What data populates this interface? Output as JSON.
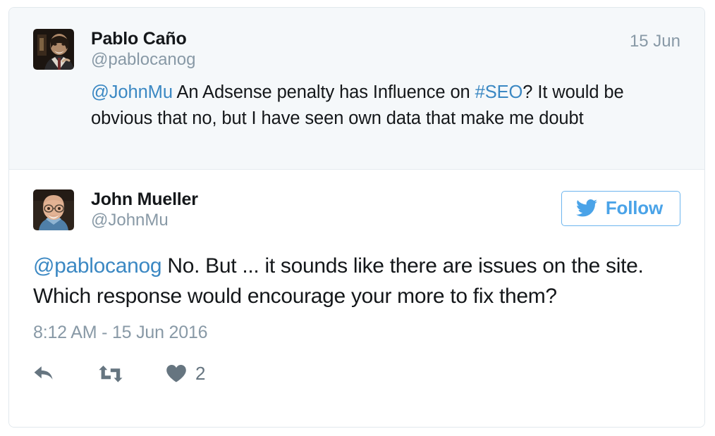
{
  "card": {
    "accent_blue": "#3b88c3",
    "follow_blue": "#4aa3e8",
    "parent_bg": "#f5f8fa",
    "border": "#e1e8ed",
    "muted": "#8899a6",
    "text": "#14171a",
    "action_gray": "#667580"
  },
  "parent_tweet": {
    "avatar_name": "pablo-cano-avatar",
    "fullname": "Pablo Caño",
    "handle": "@pablocanog",
    "date": "15 Jun",
    "text_parts": [
      {
        "type": "mention",
        "text": "@JohnMu"
      },
      {
        "type": "plain",
        "text": " An Adsense penalty has Influence on "
      },
      {
        "type": "hashtag",
        "text": "#SEO"
      },
      {
        "type": "plain",
        "text": "? It would be obvious that no, but I have seen own data that make me doubt"
      }
    ],
    "mention": "@JohnMu",
    "body_before_hashtag": " An Adsense penalty has Influence on ",
    "hashtag": "#SEO",
    "body_after_hashtag": "? It would be obvious that no, but I have seen own data that make me doubt"
  },
  "main_tweet": {
    "avatar_name": "john-mueller-avatar",
    "fullname": "John Mueller",
    "handle": "@JohnMu",
    "follow_label": "Follow",
    "mention": "@pablocanog",
    "body": " No. But ... it sounds like there are issues on the site. Which response would encourage your more to fix them?",
    "timestamp": "8:12 AM - 15 Jun 2016",
    "actions": {
      "reply": {
        "icon": "reply-icon",
        "count": ""
      },
      "retweet": {
        "icon": "retweet-icon",
        "count": ""
      },
      "like": {
        "icon": "heart-icon",
        "count": "2"
      }
    }
  }
}
